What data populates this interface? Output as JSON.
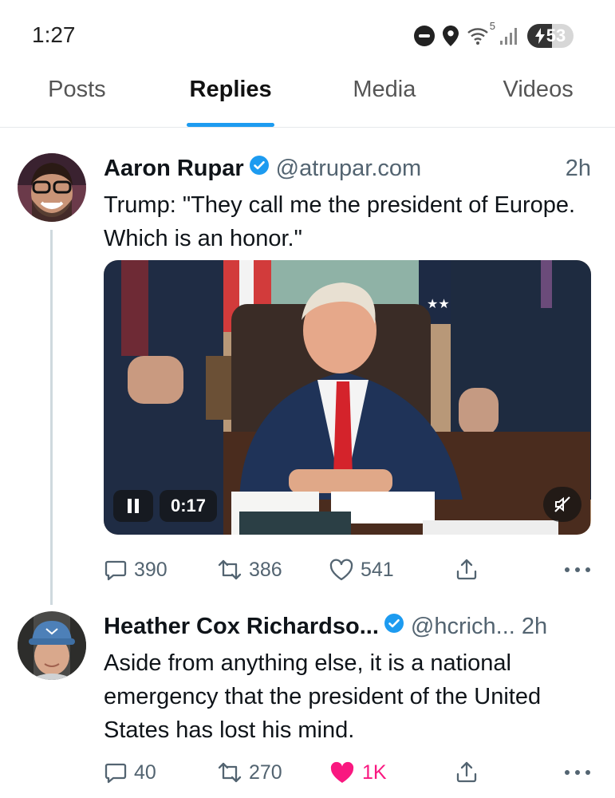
{
  "status": {
    "time": "1:27",
    "battery": "53",
    "wifi_label": "5"
  },
  "tabs": [
    {
      "label": "Posts",
      "active": false
    },
    {
      "label": "Replies",
      "active": true
    },
    {
      "label": "Media",
      "active": false
    },
    {
      "label": "Videos",
      "active": false
    }
  ],
  "posts": [
    {
      "author": "Aaron Rupar",
      "handle": "@atrupar.com",
      "time": "2h",
      "text": "Trump: \"They call me the president of Europe. Which is an honor.\"",
      "video": {
        "duration": "0:17"
      },
      "replies": "390",
      "reposts": "386",
      "likes": "541",
      "liked": false
    },
    {
      "author": "Heather Cox Richardso...",
      "handle": "@hcrich...",
      "time": "2h",
      "text": "Aside from anything else, it is a national emergency that the president of the United States has lost his mind.",
      "replies": "40",
      "reposts": "270",
      "likes": "1K",
      "liked": true
    }
  ],
  "colors": {
    "accent": "#1d9bf0",
    "like": "#f91880",
    "muted": "#536471"
  }
}
